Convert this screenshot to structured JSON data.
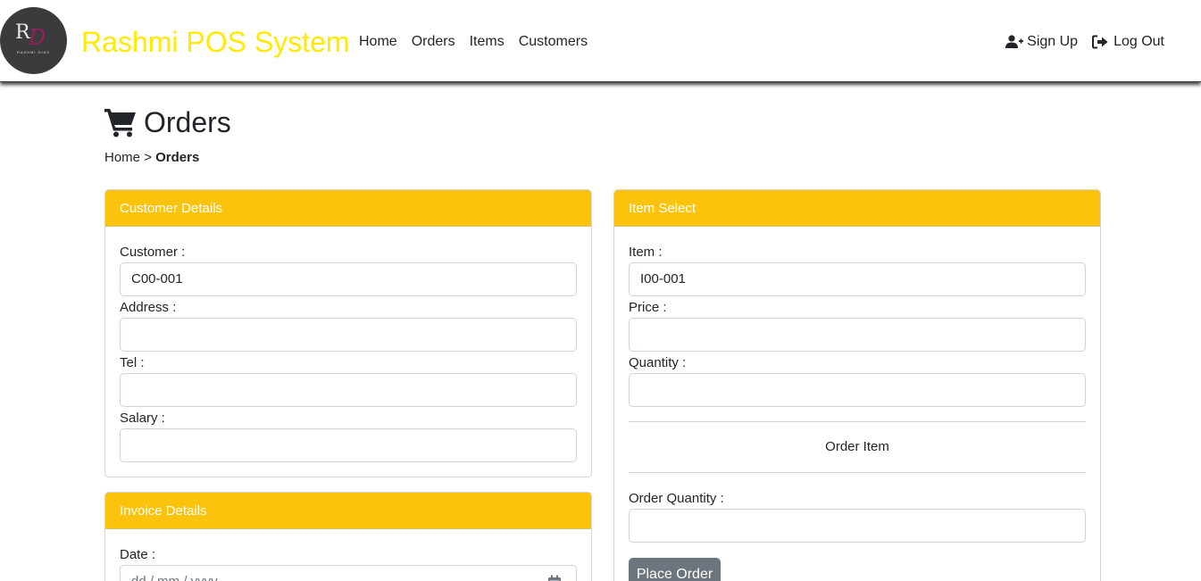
{
  "navbar": {
    "logo": {
      "monogram_r": "R",
      "monogram_d": "D",
      "subtitle": "RASHMI DIAS"
    },
    "brand": "Rashmi POS System",
    "links": [
      "Home",
      "Orders",
      "Items",
      "Customers"
    ],
    "signup_label": "Sign Up",
    "logout_label": "Log Out"
  },
  "page": {
    "title": "Orders",
    "breadcrumb_home": "Home",
    "breadcrumb_sep": ">",
    "breadcrumb_current": "Orders"
  },
  "customer_card": {
    "header": "Customer Details",
    "customer_label": "Customer :",
    "customer_value": "C00-001",
    "address_label": "Address :",
    "tel_label": "Tel :",
    "salary_label": "Salary :"
  },
  "invoice_card": {
    "header": "Invoice Details",
    "date_label": "Date :",
    "date_placeholder": "dd / mm / yyyy"
  },
  "item_card": {
    "header": "Item Select",
    "item_label": "Item :",
    "item_value": "I00-001",
    "price_label": "Price :",
    "quantity_label": "Quantity :",
    "section_title": "Order Item",
    "order_qty_label": "Order Quantity :",
    "place_order_label": "Place Order"
  },
  "colors": {
    "accent": "#fcc30c",
    "brand": "#ffea00",
    "button": "#6c757d"
  }
}
